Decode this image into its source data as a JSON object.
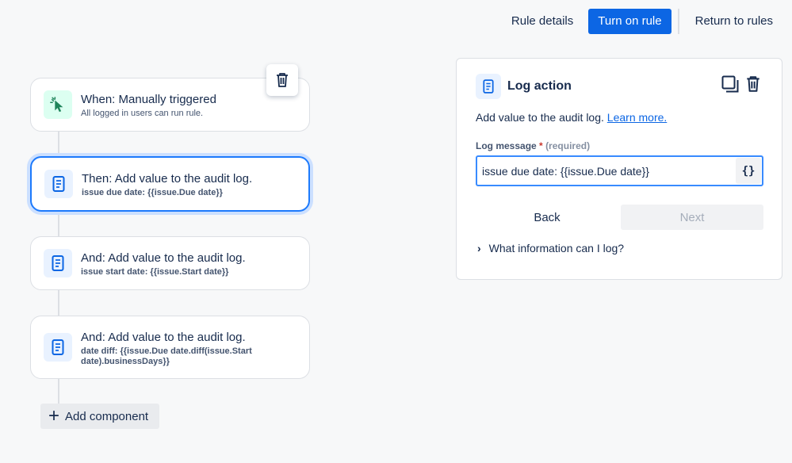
{
  "header": {
    "rule_details": "Rule details",
    "turn_on_rule": "Turn on rule",
    "return_to_rules": "Return to rules"
  },
  "flow": {
    "trigger": {
      "title": "When: Manually triggered",
      "subtitle": "All logged in users can run rule.",
      "icon": "cursor-click-icon"
    },
    "steps": [
      {
        "title": "Then: Add value to the audit log.",
        "subtitle": "issue due date: {{issue.Due date}}",
        "icon": "document-icon"
      },
      {
        "title": "And: Add value to the audit log.",
        "subtitle": "issue start date: {{issue.Start date}}",
        "icon": "document-icon"
      },
      {
        "title": "And: Add value to the audit log.",
        "subtitle_line1": "date diff: {{issue.Due date.diff(issue.Start",
        "subtitle_line2": "date).businessDays}}",
        "icon": "document-icon"
      }
    ],
    "add_component": "Add component"
  },
  "panel": {
    "title": "Log action",
    "description": "Add value to the audit log.",
    "learn_more": "Learn more.",
    "field_label": "Log message",
    "required_mark": "*",
    "required_hint": "(required)",
    "field_value": "issue due date: {{issue.Due date}}",
    "braces": "{}",
    "back": "Back",
    "next": "Next",
    "help_toggle": "What information can I log?"
  },
  "colors": {
    "primary": "#0c66e4",
    "selected_border": "#1d7afc",
    "trigger_icon_bg": "#dcfff1",
    "action_icon_bg": "#e9f2ff"
  }
}
